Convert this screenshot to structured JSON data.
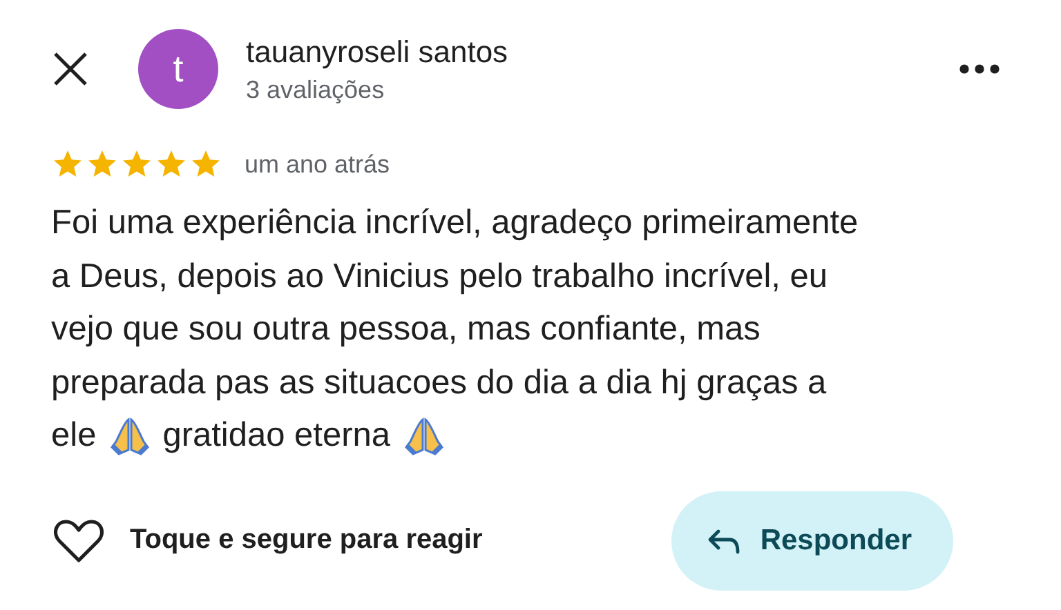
{
  "header": {
    "avatar_letter": "t",
    "name": "tauanyroseli santos",
    "subtitle": "3 avaliações"
  },
  "review": {
    "stars": 5,
    "time": "um ano atrás",
    "lines": [
      {
        "parts": [
          {
            "kind": "text",
            "text": "Foi uma experiência incrível, agradeço primeiramente"
          }
        ]
      },
      {
        "parts": [
          {
            "kind": "text",
            "text": "a Deus, depois ao Vinicius pelo trabalho incrível, eu"
          }
        ]
      },
      {
        "parts": [
          {
            "kind": "text",
            "text": "vejo que sou outra pessoa, mas confiante, mas"
          }
        ]
      },
      {
        "parts": [
          {
            "kind": "text",
            "text": "preparada pas as situacoes do dia a dia hj graças a"
          }
        ]
      },
      {
        "parts": [
          {
            "kind": "text",
            "text": "ele"
          },
          {
            "kind": "praying"
          },
          {
            "kind": "text",
            "text": "gratidao eterna"
          },
          {
            "kind": "praying"
          }
        ]
      }
    ]
  },
  "footer": {
    "react_hint": "Toque e segure para reagir",
    "reply_button": "Responder"
  }
}
